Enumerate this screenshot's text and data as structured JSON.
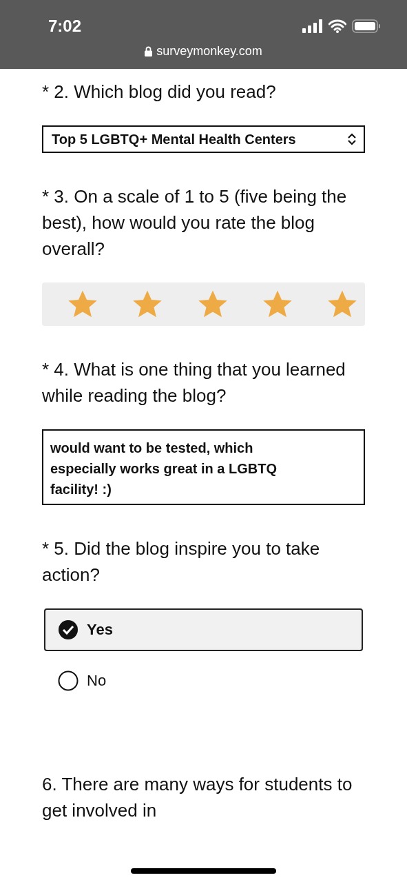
{
  "status_bar": {
    "time": "7:02",
    "url": "surveymonkey.com"
  },
  "questions": [
    {
      "kind": "dropdown",
      "title": "* 2. Which blog did you read?",
      "value": "Top 5 LGBTQ+ Mental Health Centers"
    },
    {
      "kind": "rating",
      "title": "* 3. On a scale of 1 to 5 (five being the best), how would you rate the blog overall?",
      "stars": 5
    },
    {
      "kind": "text",
      "title": "* 4. What is one thing that you learned while reading the blog?",
      "value": "would want to be tested, which especially works great in a LGBTQ facility! :)"
    },
    {
      "kind": "choice",
      "title": "* 5. Did the blog inspire you to take action?",
      "options": [
        {
          "label": "Yes",
          "selected": true
        },
        {
          "label": "No",
          "selected": false
        }
      ]
    },
    {
      "kind": "plain",
      "title": "6. There are many ways for students to get involved in"
    }
  ]
}
